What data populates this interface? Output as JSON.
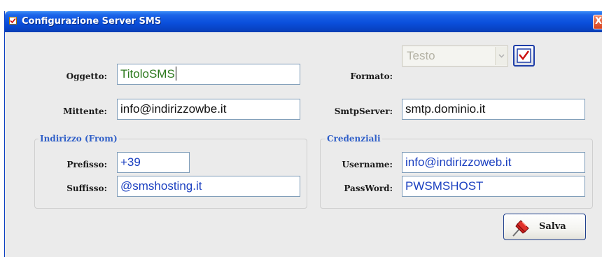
{
  "window": {
    "title": "Configurazione Server SMS",
    "close_glyph": "X"
  },
  "form": {
    "oggetto_label": "Oggetto:",
    "oggetto_value": "TitoloSMS",
    "mittente_label": "Mittente:",
    "mittente_value": "info@indirizzowbe.it",
    "formato_label": "Formato:",
    "formato_value": "Testo",
    "smtp_label": "SmtpServer:",
    "smtp_value": "smtp.dominio.it"
  },
  "indirizzo": {
    "title": "Indirizzo (From)",
    "prefisso_label": "Prefisso:",
    "prefisso_value": "+39",
    "suffisso_label": "Suffisso:",
    "suffisso_value": "@smshosting.it"
  },
  "credenziali": {
    "title": "Credenziali",
    "username_label": "Username:",
    "username_value": "info@indirizzoweb.it",
    "password_label": "PassWord:",
    "password_value": "PWSMSHOST"
  },
  "actions": {
    "save_label": "Salva"
  },
  "icons": {
    "title_icon": "checkbox-icon",
    "formato_checkbox": "checkbox-checked-icon",
    "save_icon": "pushpin-icon",
    "combo_arrow": "chevron-down-icon"
  },
  "colors": {
    "titlebar": "#0a4fdc",
    "field_text_blue": "#1a3fc0",
    "field_text_green": "#2d7a1e",
    "group_title": "#2f5fc8",
    "pin_red": "#c8201c"
  }
}
